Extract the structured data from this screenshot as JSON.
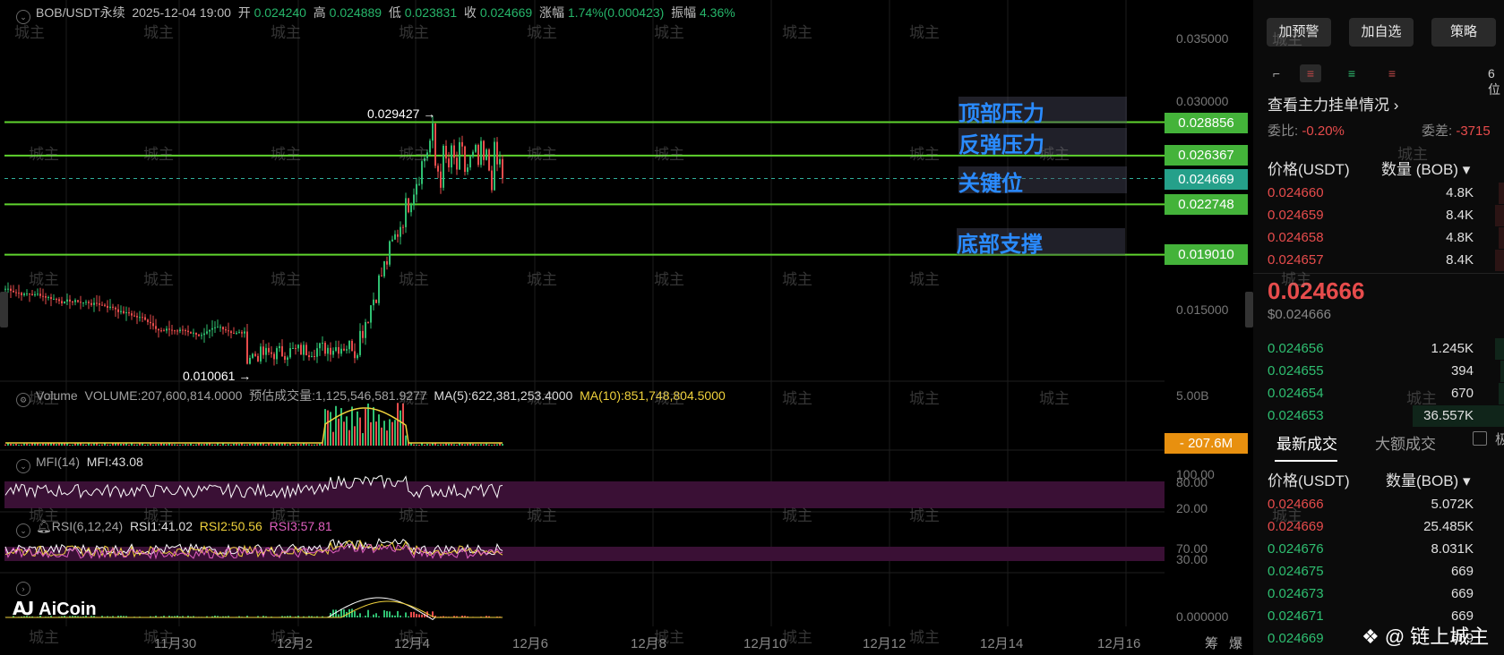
{
  "header": {
    "symbol": "BOB/USDT永续",
    "datetime": "2025-12-04 19:00",
    "open_label": "开",
    "open": "0.024240",
    "high_label": "高",
    "high": "0.024889",
    "low_label": "低",
    "low": "0.023831",
    "close_label": "收",
    "close": "0.024669",
    "change_label": "涨幅",
    "change": "1.74%(0.000423)",
    "amp_label": "振幅",
    "amp": "4.36%"
  },
  "levels": [
    {
      "label": "顶部压力",
      "price": "0.028856",
      "value": 0.028856
    },
    {
      "label": "反弹压力",
      "price": "0.026367",
      "value": 0.026367
    },
    {
      "label": "关键位",
      "price": "0.024669",
      "value": 0.024669
    },
    {
      "label": "",
      "price": "0.022748",
      "value": 0.022748
    },
    {
      "label": "底部支撑",
      "price": "0.019010",
      "value": 0.01901
    }
  ],
  "annotations": {
    "high_mark": "0.029427",
    "low_mark": "0.010061"
  },
  "price_axis": [
    "0.035000",
    "0.030000",
    "0.015000"
  ],
  "date_axis": [
    "11月30",
    "12月2",
    "12月4",
    "12月6",
    "12月8",
    "12月10",
    "12月12",
    "12月14",
    "12月16"
  ],
  "indicators": {
    "volume": {
      "name": "Volume",
      "value": "VOLUME:207,600,814.0000",
      "pred": "预估成交量:1,125,546,581.9277",
      "ma5": "MA(5):622,381,253.4000",
      "ma10": "MA(10):851,748,804.5000",
      "axis_top": "5.00B",
      "tag": "207.6M"
    },
    "mfi": {
      "name": "MFI(14)",
      "value": "MFI:43.08",
      "axis": [
        "100.00",
        "80.00",
        "20.00"
      ]
    },
    "rsi": {
      "name": "RSI(6,12,24)",
      "rsi1": "RSI1:41.02",
      "rsi2": "RSI2:50.56",
      "rsi3": "RSI3:57.81",
      "axis": [
        "70.00",
        "30.00"
      ]
    },
    "macd": {
      "axis": "0.000000"
    }
  },
  "corner_labels": [
    "筹",
    "爆"
  ],
  "logo": "AiCoin",
  "watermark": "城主",
  "brand": "@ 链上城主",
  "right_panel": {
    "buttons": [
      "加预警",
      "加自选",
      "策略"
    ],
    "precision": "6位",
    "orderbook_title": "查看主力挂单情况",
    "ratio_label": "委比:",
    "ratio": "-0.20%",
    "diff_label": "委差:",
    "diff": "-3715",
    "col_price": "价格(USDT)",
    "col_qty": "数量 (BOB)",
    "asks": [
      {
        "price": "0.024660",
        "qty": "4.8K"
      },
      {
        "price": "0.024659",
        "qty": "8.4K"
      },
      {
        "price": "0.024658",
        "qty": "4.8K"
      },
      {
        "price": "0.024657",
        "qty": "8.4K"
      }
    ],
    "mid_price": "0.024666",
    "mid_usd": "$0.024666",
    "bids": [
      {
        "price": "0.024656",
        "qty": "1.245K"
      },
      {
        "price": "0.024655",
        "qty": "394"
      },
      {
        "price": "0.024654",
        "qty": "670"
      },
      {
        "price": "0.024653",
        "qty": "36.557K"
      }
    ],
    "tabs": [
      "最新成交",
      "大额成交"
    ],
    "checkbox_label": "极",
    "trades_col_price": "价格(USDT)",
    "trades_col_qty": "数量(BOB)",
    "trades": [
      {
        "price": "0.024666",
        "qty": "5.072K",
        "side": "sell"
      },
      {
        "price": "0.024669",
        "qty": "25.485K",
        "side": "sell"
      },
      {
        "price": "0.024676",
        "qty": "8.031K",
        "side": "buy"
      },
      {
        "price": "0.024675",
        "qty": "669",
        "side": "buy"
      },
      {
        "price": "0.024673",
        "qty": "669",
        "side": "buy"
      },
      {
        "price": "0.024671",
        "qty": "669",
        "side": "buy"
      },
      {
        "price": "0.024669",
        "qty": "669",
        "side": "buy"
      }
    ]
  },
  "colors": {
    "up": "#2fbf71",
    "down": "#e74c4c",
    "level": "#5fd32e",
    "accent": "#2a8bff"
  }
}
